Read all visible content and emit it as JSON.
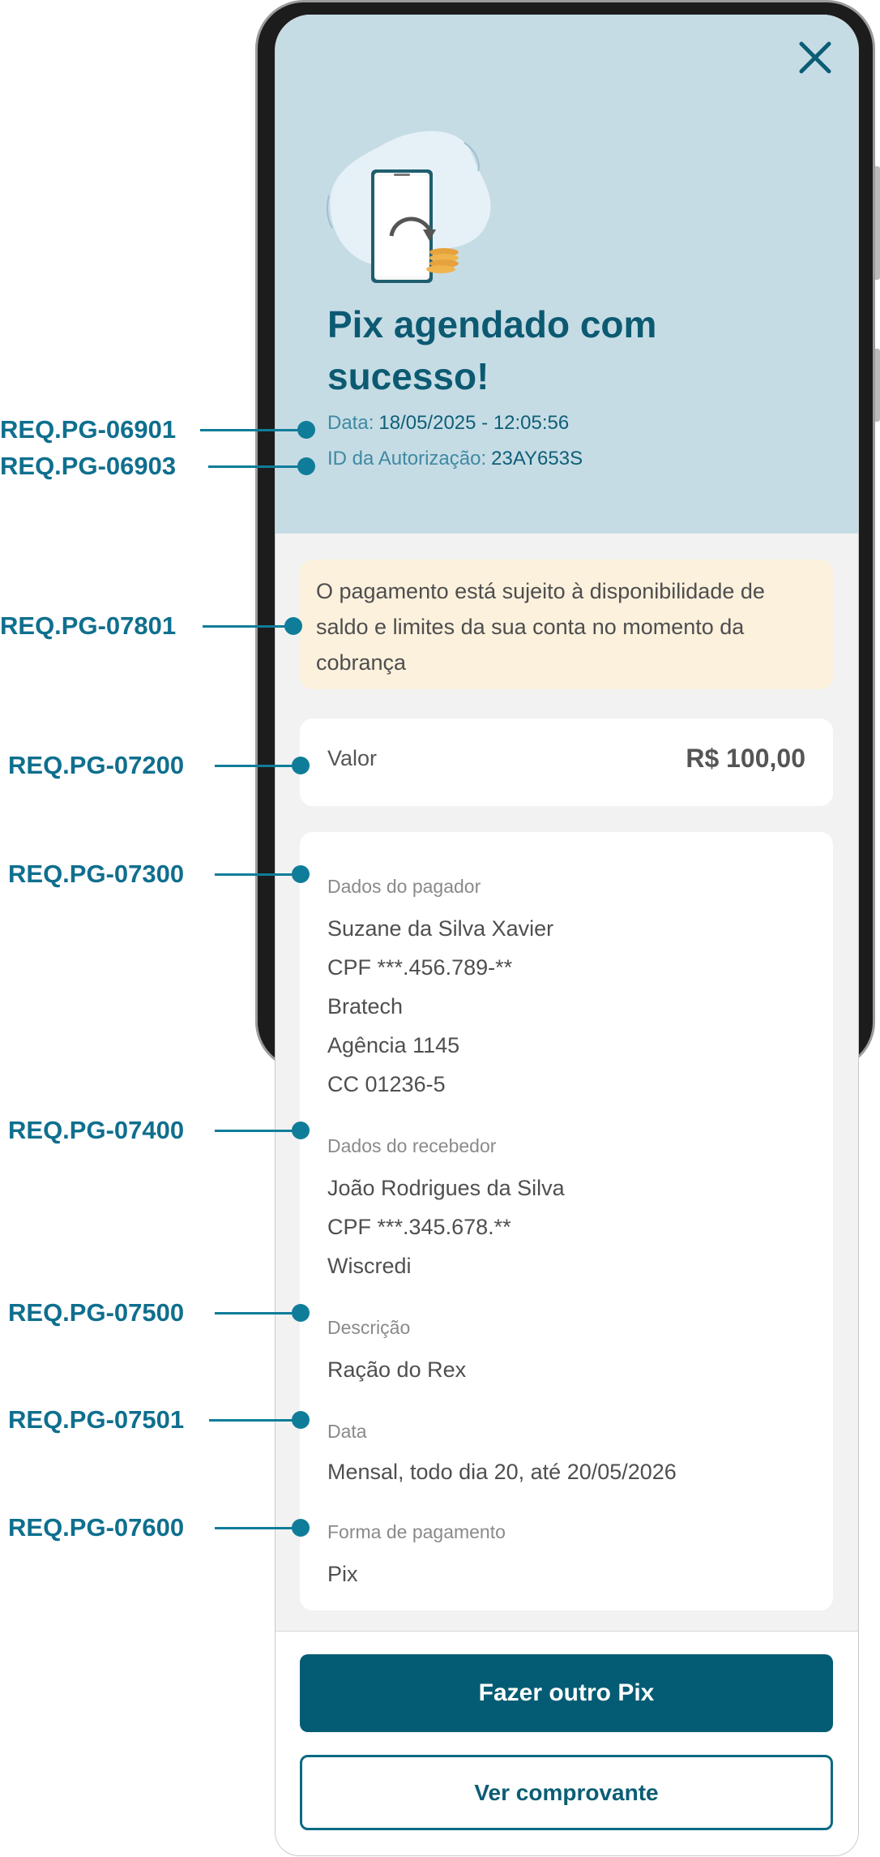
{
  "annotations": [
    {
      "label": "REQ.PG-06901"
    },
    {
      "label": "REQ.PG-06903"
    },
    {
      "label": "REQ.PG-07801"
    },
    {
      "label": "REQ.PG-07200"
    },
    {
      "label": "REQ.PG-07300"
    },
    {
      "label": "REQ.PG-07400"
    },
    {
      "label": "REQ.PG-07500"
    },
    {
      "label": "REQ.PG-07501"
    },
    {
      "label": "REQ.PG-07600"
    }
  ],
  "header": {
    "close_icon": "close-icon",
    "illustration": "phone-payment-illustration",
    "title": "Pix agendado com sucesso!",
    "date_label": "Data:",
    "date_value": "18/05/2025 - 12:05:56",
    "auth_label": "ID da Autorização:",
    "auth_value": "23AY653S"
  },
  "notice": {
    "text": "O pagamento está sujeito à disponibilidade de saldo e limites da sua conta no momento da cobrança"
  },
  "valor": {
    "label": "Valor",
    "value": "R$ 100,00"
  },
  "details": {
    "payer": {
      "label": "Dados do pagador",
      "lines": [
        "Suzane da Silva Xavier",
        "CPF ***.456.789-**",
        "Bratech",
        "Agência 1145",
        "CC 01236-5"
      ]
    },
    "receiver": {
      "label": "Dados do recebedor",
      "lines": [
        "João Rodrigues da Silva",
        "CPF ***.345.678.**",
        "Wiscredi"
      ]
    },
    "description": {
      "label": "Descrição",
      "value": "Ração do Rex"
    },
    "date": {
      "label": "Data",
      "value": "Mensal, todo dia 20, até 20/05/2026"
    },
    "payment_method": {
      "label": "Forma de pagamento",
      "value": "Pix"
    }
  },
  "buttons": {
    "primary": "Fazer outro Pix",
    "secondary": "Ver comprovante"
  },
  "colors": {
    "brand": "#035c73",
    "annotation": "#0f7d99",
    "hero_background": "#c6dce5",
    "notice_background": "#fbf1dd"
  }
}
